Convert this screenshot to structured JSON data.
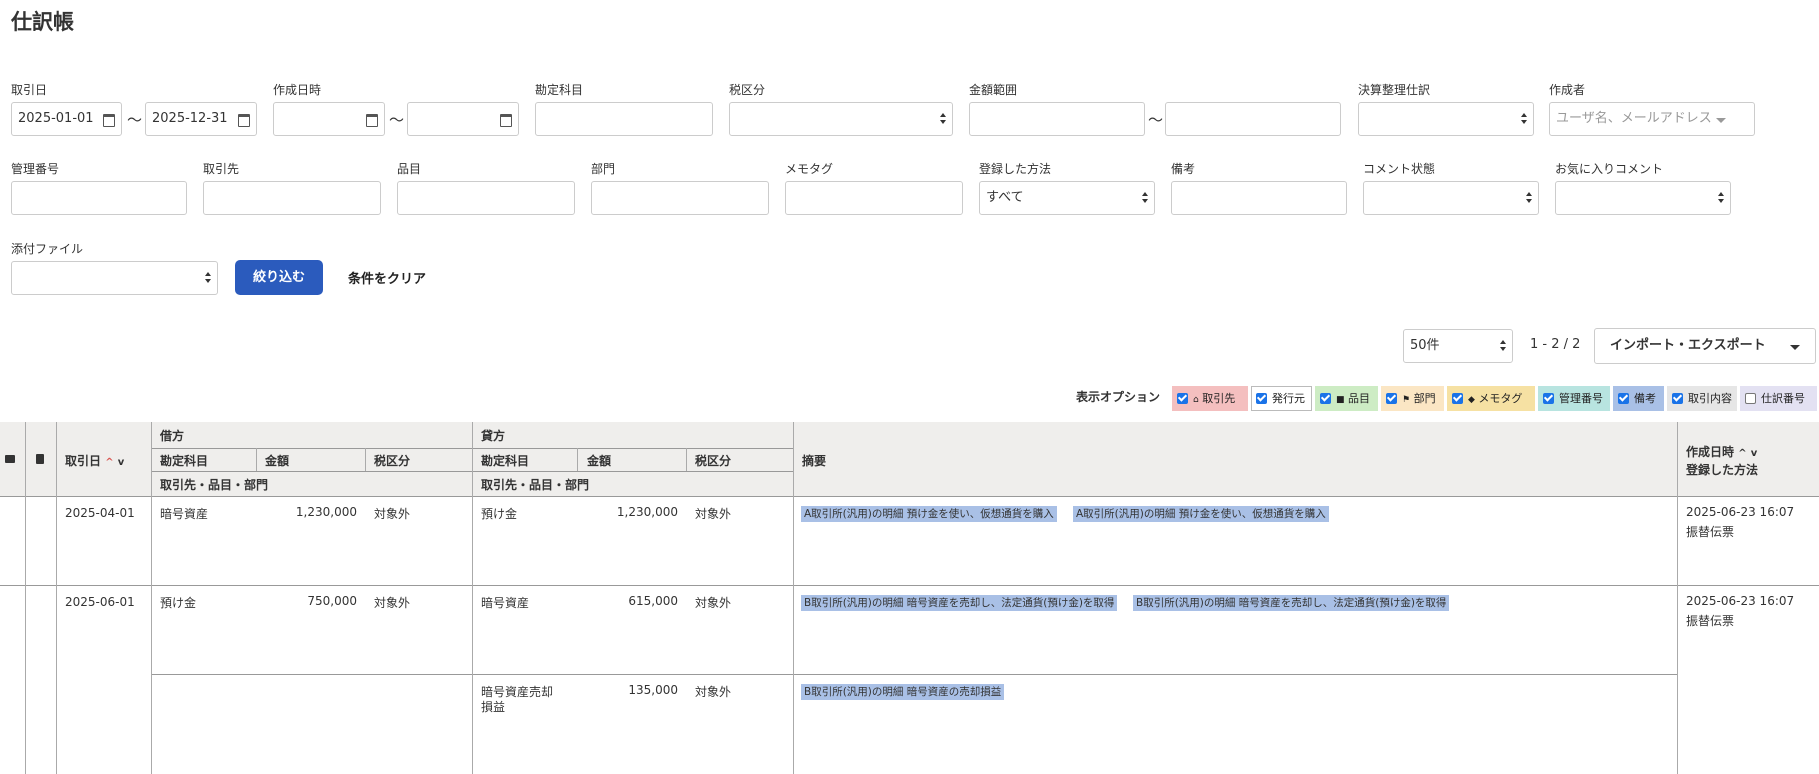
{
  "page": {
    "title": "仕訳帳"
  },
  "filters": {
    "torihikibi": {
      "label": "取引日",
      "from": "2025-01-01",
      "to": "2025-12-31"
    },
    "sakusei": {
      "label": "作成日時",
      "from": "",
      "to": ""
    },
    "kanjo": {
      "label": "勘定科目"
    },
    "zei": {
      "label": "税区分"
    },
    "kingaku": {
      "label": "金額範囲"
    },
    "kessan": {
      "label": "決算整理仕訳"
    },
    "sakuseisha": {
      "label": "作成者",
      "placeholder": "ユーザ名、メールアドレス"
    },
    "kanri": {
      "label": "管理番号"
    },
    "torihikisaki": {
      "label": "取引先"
    },
    "hinmoku": {
      "label": "品目"
    },
    "bumon": {
      "label": "部門"
    },
    "memo": {
      "label": "メモタグ"
    },
    "hoho": {
      "label": "登録した方法",
      "value": "すべて"
    },
    "biko": {
      "label": "備考"
    },
    "comment": {
      "label": "コメント状態"
    },
    "okini": {
      "label": "お気に入りコメント"
    },
    "tenpu": {
      "label": "添付ファイル"
    },
    "tilde": "〜",
    "submit": "絞り込む",
    "clear": "条件をクリア"
  },
  "pager": {
    "per_page": "50件",
    "range": "1 - 2 / 2",
    "export": "インポート・エクスポート"
  },
  "options": {
    "label": "表示オプション",
    "items": [
      {
        "label": "取引先",
        "checked": true,
        "color": "#f4bfbf",
        "icon": "home-icon"
      },
      {
        "label": "発行元",
        "checked": true,
        "color": "#ffffff",
        "icon": ""
      },
      {
        "label": "品目",
        "checked": true,
        "color": "#cdecc4",
        "icon": "bag-icon"
      },
      {
        "label": "部門",
        "checked": true,
        "color": "#fbe6c4",
        "icon": "flag-icon"
      },
      {
        "label": "メモタグ",
        "checked": true,
        "color": "#f6e1a3",
        "icon": "tag-icon"
      },
      {
        "label": "管理番号",
        "checked": true,
        "color": "#b8e4e0",
        "icon": ""
      },
      {
        "label": "備考",
        "checked": true,
        "color": "#a9c0e6",
        "icon": ""
      },
      {
        "label": "取引内容",
        "checked": true,
        "color": "#e6e6e6",
        "icon": ""
      },
      {
        "label": "仕訳番号",
        "checked": false,
        "color": "#e3e1f2",
        "icon": ""
      }
    ]
  },
  "table": {
    "headers": {
      "date": "取引日",
      "debit": "借方",
      "credit": "貸方",
      "account": "勘定科目",
      "amount": "金額",
      "tax": "税区分",
      "partner": "取引先・品目・部門",
      "summary": "摘要",
      "created": "作成日時",
      "method": "登録した方法"
    },
    "rows": [
      {
        "date": "2025-04-01",
        "debit_account": "暗号資産",
        "debit_amount": "1,230,000",
        "debit_tax": "対象外",
        "credit_account": "預け金",
        "credit_amount": "1,230,000",
        "credit_tax": "対象外",
        "tags": [
          "A取引所(汎用)の明細 預け金を使い、仮想通貨を購入",
          "A取引所(汎用)の明細 預け金を使い、仮想通貨を購入"
        ],
        "created": "2025-06-23 16:07",
        "method": "振替伝票"
      },
      {
        "date": "2025-06-01",
        "debit_account": "預け金",
        "debit_amount": "750,000",
        "debit_tax": "対象外",
        "credit_account": "暗号資産",
        "credit_amount": "615,000",
        "credit_tax": "対象外",
        "tags": [
          "B取引所(汎用)の明細 暗号資産を売却し、法定通貨(預け金)を取得",
          "B取引所(汎用)の明細 暗号資産を売却し、法定通貨(預け金)を取得"
        ],
        "created": "2025-06-23 16:07",
        "method": "振替伝票"
      },
      {
        "credit_account_line1": "暗号資産売却",
        "credit_account_line2": "損益",
        "credit_amount": "135,000",
        "credit_tax": "対象外",
        "tags": [
          "B取引所(汎用)の明細 暗号資産の売却損益"
        ]
      }
    ]
  }
}
